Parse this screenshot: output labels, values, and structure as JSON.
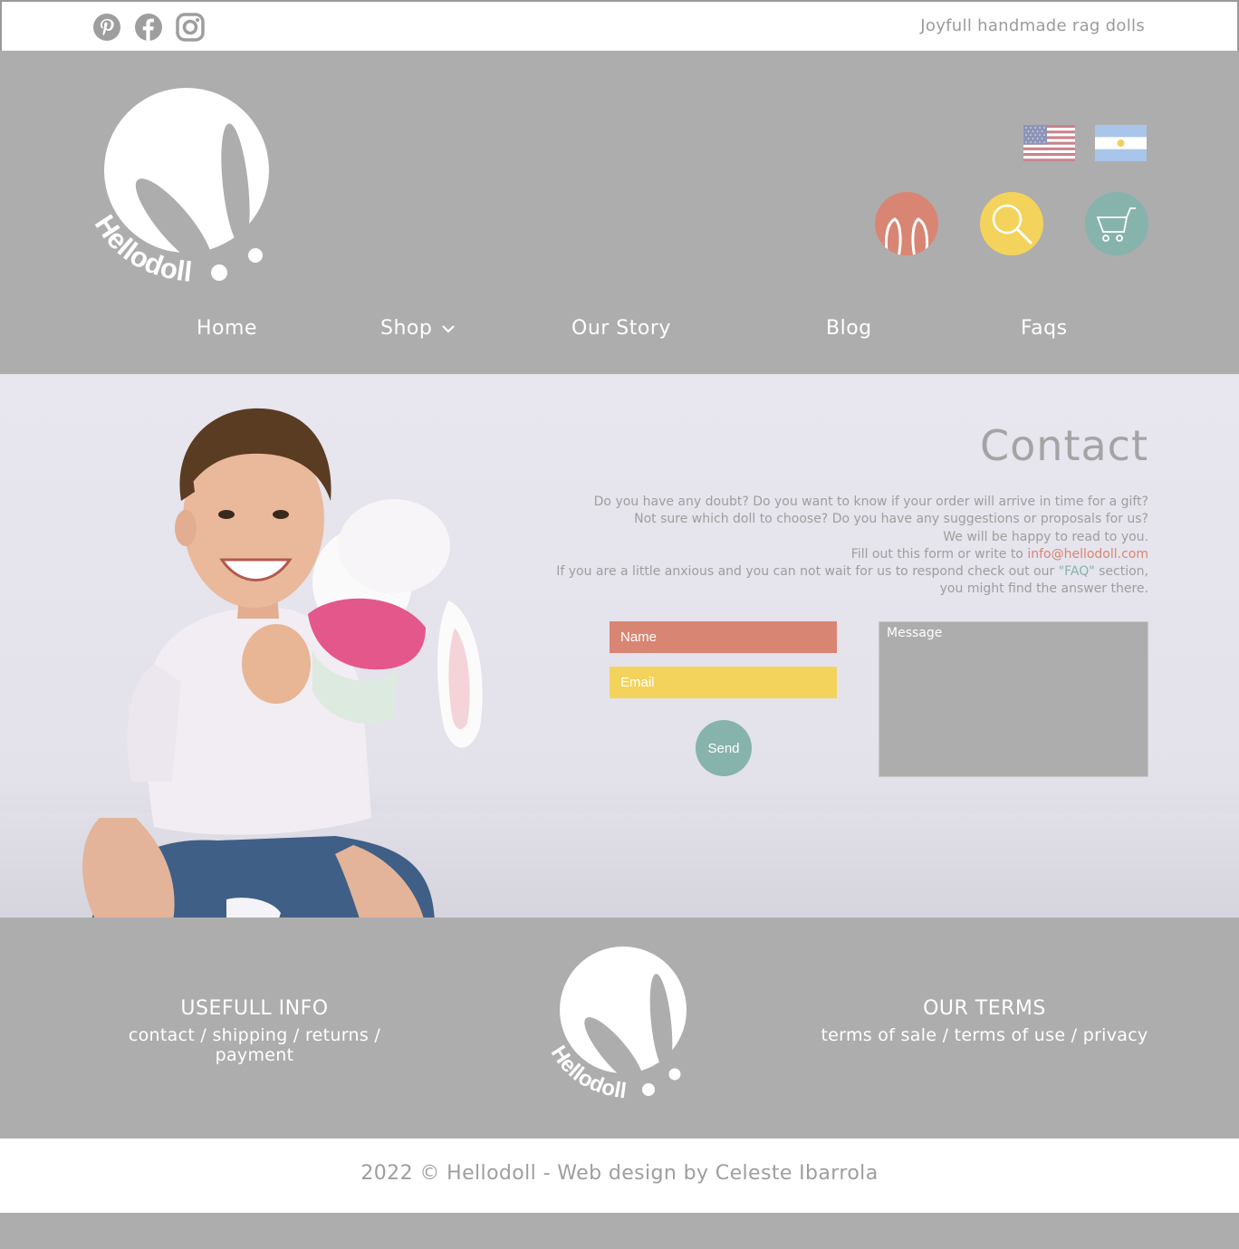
{
  "topbar": {
    "social": [
      "pinterest-icon",
      "facebook-icon",
      "instagram-icon"
    ],
    "tagline": "Joyfull handmade rag dolls"
  },
  "brand": {
    "logo_text": "Hellodoll"
  },
  "header": {
    "flags": [
      "usa-flag-icon",
      "argentina-flag-icon"
    ],
    "circle_buttons": [
      {
        "icon": "rabbit-ears-icon",
        "color": "#d98573"
      },
      {
        "icon": "search-icon",
        "color": "#f4d35c"
      },
      {
        "icon": "cart-icon",
        "color": "#86b3ab"
      }
    ]
  },
  "nav": {
    "home": "Home",
    "shop": "Shop",
    "our_story": "Our Story",
    "blog": "Blog",
    "faqs": "Faqs"
  },
  "contact": {
    "title": "Contact",
    "line1": "Do you have any doubt? Do you want to know if your order will arrive in time for a gift?",
    "line2": "Not sure which doll to choose? Do you have any suggestions or proposals for us?",
    "line3": "We will be happy to read to you.",
    "line4_prefix": "Fill out this form or write to ",
    "email": "info@hellodoll.com",
    "line5_prefix": "If you are a little anxious and you can not wait for us to respond check out our ",
    "faq_link": "\"FAQ\"",
    "line5_suffix": " section,",
    "line6": "you might find the answer there.",
    "form": {
      "name_placeholder": "Name",
      "email_placeholder": "Email",
      "message_placeholder": "Message",
      "send_label": "Send"
    }
  },
  "footer": {
    "useful_title": "USEFULL INFO",
    "useful_links": [
      "contact",
      "shipping",
      "returns",
      "payment"
    ],
    "terms_title": "OUR TERMS",
    "terms_links": [
      "terms of sale",
      "terms of use",
      "privacy"
    ],
    "copyright": "2022 © Hellodoll - Web design by Celeste Ibarrola"
  },
  "colors": {
    "gray": "#adadad",
    "coral": "#d98573",
    "yellow": "#f4d35c",
    "teal": "#86b3ab"
  }
}
